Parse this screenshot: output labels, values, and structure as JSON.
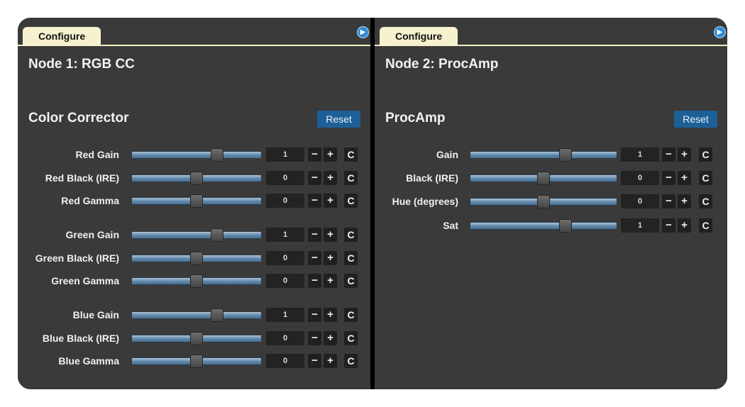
{
  "panels": [
    {
      "tab_label": "Configure",
      "node_title": "Node 1: RGB CC",
      "section_title": "Color Corrector",
      "reset_label": "Reset",
      "rows": [
        {
          "label": "Red Gain",
          "value": "1",
          "fraction": 0.66
        },
        {
          "label": "Red Black (IRE)",
          "value": "0",
          "fraction": 0.5
        },
        {
          "label": "Red Gamma",
          "value": "0",
          "fraction": 0.5
        },
        {
          "label": "Green Gain",
          "value": "1",
          "fraction": 0.66
        },
        {
          "label": "Green Black (IRE)",
          "value": "0",
          "fraction": 0.5
        },
        {
          "label": "Green Gamma",
          "value": "0",
          "fraction": 0.5
        },
        {
          "label": "Blue Gain",
          "value": "1",
          "fraction": 0.66
        },
        {
          "label": "Blue Black (IRE)",
          "value": "0",
          "fraction": 0.5
        },
        {
          "label": "Blue Gamma",
          "value": "0",
          "fraction": 0.5
        }
      ]
    },
    {
      "tab_label": "Configure",
      "node_title": "Node 2: ProcAmp",
      "section_title": "ProcAmp",
      "reset_label": "Reset",
      "rows": [
        {
          "label": "Gain",
          "value": "1",
          "fraction": 0.65
        },
        {
          "label": "Black (IRE)",
          "value": "0",
          "fraction": 0.5
        },
        {
          "label": "Hue (degrees)",
          "value": "0",
          "fraction": 0.5
        },
        {
          "label": "Sat",
          "value": "1",
          "fraction": 0.65
        }
      ]
    }
  ],
  "buttons": {
    "minus": "−",
    "plus": "+",
    "reset_icon": "C"
  },
  "icons": {
    "nav": "chevron-right-circle-icon",
    "reset": "refresh-icon"
  },
  "colors": {
    "panel_bg": "#3a3a3a",
    "tab_bg": "#f6f1cf",
    "reset_button": "#1d5f97",
    "nav_icon": "#2f8bd6"
  }
}
